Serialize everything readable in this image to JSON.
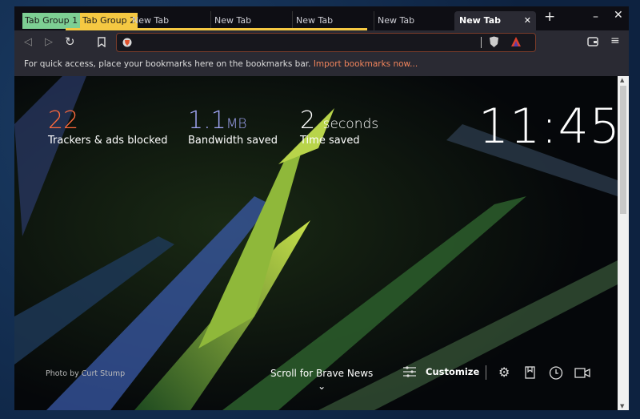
{
  "tab_groups": [
    {
      "label": "Tab Group 1",
      "color": "#7dcf93"
    },
    {
      "label": "Tab Group 2",
      "color": "#f5c842"
    }
  ],
  "tabs": [
    {
      "label": "New Tab"
    },
    {
      "label": "New Tab"
    },
    {
      "label": "New Tab"
    },
    {
      "label": "New Tab"
    },
    {
      "label": "New Tab",
      "active": true
    }
  ],
  "window": {
    "new_tab": "+",
    "minimize": "–",
    "close": "✕",
    "tab_close": "✕"
  },
  "address": {
    "value": ""
  },
  "bookmarks_bar": {
    "message": "For quick access, place your bookmarks here on the bookmarks bar.",
    "import_link": "Import bookmarks now..."
  },
  "stats": [
    {
      "value": "22",
      "unit": "",
      "label": "Trackers & ads blocked",
      "color": "#ff6a3d"
    },
    {
      "value": "1.1",
      "unit": "MB",
      "label": "Bandwidth saved",
      "color": "#a0a5f5"
    },
    {
      "value": "2",
      "unit": "seconds",
      "label": "Time saved",
      "color": "#ffffff"
    }
  ],
  "clock": "11:45",
  "photo_credit": "Photo by Curt Stump",
  "news": {
    "label": "Scroll for Brave News"
  },
  "customize": {
    "label": "Customize"
  }
}
